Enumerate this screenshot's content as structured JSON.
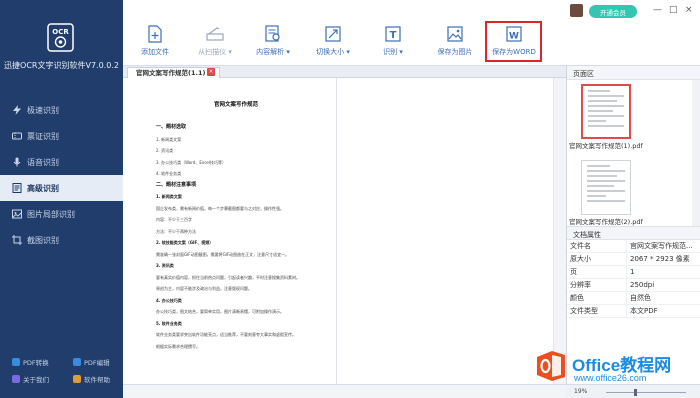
{
  "app": {
    "title": "迅捷OCR文字识别软件V7.0.0.2",
    "logo_text": "OCR"
  },
  "sidebar": {
    "items": [
      {
        "label": "极速识别",
        "icon": "lightning-icon"
      },
      {
        "label": "票证识别",
        "icon": "ticket-icon"
      },
      {
        "label": "语音识别",
        "icon": "microphone-icon"
      },
      {
        "label": "高级识别",
        "icon": "page-icon",
        "active": true
      },
      {
        "label": "图片局部识别",
        "icon": "crop-icon"
      },
      {
        "label": "截图识别",
        "icon": "screenshot-icon"
      }
    ],
    "bottom_links": [
      {
        "label": "PDF转换",
        "color": "#3a8be0"
      },
      {
        "label": "PDF编辑",
        "color": "#3a8be0"
      },
      {
        "label": "关于我们",
        "color": "#7a6be0"
      },
      {
        "label": "软件帮助",
        "color": "#e09a3a"
      }
    ]
  },
  "header": {
    "vip_label": "开通会员",
    "window_controls": [
      "—",
      "□",
      "×"
    ]
  },
  "toolbar": {
    "tools": [
      {
        "label": "添加文件",
        "icon": "add-file-icon"
      },
      {
        "label": "从扫描仪 ▾",
        "icon": "scanner-icon"
      },
      {
        "label": "内容解析 ▾",
        "icon": "parse-icon"
      },
      {
        "label": "切换大小 ▾",
        "icon": "resize-icon"
      },
      {
        "label": "识别 ▾",
        "icon": "recognize-icon"
      },
      {
        "label": "保存为图片",
        "icon": "save-image-icon"
      },
      {
        "label": "保存为WORD",
        "icon": "save-word-icon"
      }
    ]
  },
  "document": {
    "tab_label": "官网文案写作规范(1.1)",
    "title": "官网文案写作规范",
    "lines": [
      {
        "t": "一、题材选取",
        "cls": "h"
      },
      {
        "t": "1. 新闻类文案",
        "cls": ""
      },
      {
        "t": "2. 资讯类",
        "cls": ""
      },
      {
        "t": "3. 办公技巧类（Word、Excel技巧等）",
        "cls": ""
      },
      {
        "t": "4. 软件业务类",
        "cls": ""
      },
      {
        "t": "二、题材注意事项",
        "cls": "h"
      },
      {
        "t": "1. 新闻类文案",
        "cls": "sub"
      },
      {
        "t": "国企发布类，需有新闻价值，每一个步骤截图都要与之对应，操作性强。",
        "cls": ""
      },
      {
        "t": "内容：不少于三百字",
        "cls": ""
      },
      {
        "t": "方法：不少于两种方法",
        "cls": ""
      },
      {
        "t": "2. 软技能类文案（GIF、视频）",
        "cls": "sub"
      },
      {
        "t": "需准确一张封面GIF动图截图，需要将GIF动图放在正文，注意尺寸适宜一。",
        "cls": ""
      },
      {
        "t": "3. 资讯类",
        "cls": "sub"
      },
      {
        "t": "要有真实价值内容，抓住当前热点问题，引起读者兴趣，平时注意搜集资料素材。",
        "cls": ""
      },
      {
        "t": "原创为主，内容不能涉及政治与利益，注意版权问题。",
        "cls": ""
      },
      {
        "t": "4. 办公技巧类",
        "cls": "sub"
      },
      {
        "t": "办公技巧类，图文结合，要简单实用，图片清晰易懂，可附加操作演示。",
        "cls": ""
      },
      {
        "t": "5. 软件业务类",
        "cls": "sub"
      },
      {
        "t": "软件业务类要求突出软件功能亮点，适当推荐，不要刻意夸大事实和虚假宣传。",
        "cls": ""
      },
      {
        "t": "根据实际需求合理撰写。",
        "cls": ""
      }
    ]
  },
  "page_panel": {
    "title": "页面区",
    "thumbs": [
      {
        "label": "官网文案写作规范(1).pdf",
        "selected": true
      },
      {
        "label": "官网文案写作规范(2).pdf",
        "selected": false
      }
    ]
  },
  "properties": {
    "title": "文档属性",
    "rows": [
      {
        "k": "文件名",
        "v": "官网文案写作规范..."
      },
      {
        "k": "原大小",
        "v": "2067 * 2923 像素"
      },
      {
        "k": "页",
        "v": "1"
      },
      {
        "k": "分辨率",
        "v": "250dpi"
      },
      {
        "k": "颜色",
        "v": "自然色"
      },
      {
        "k": "文件类型",
        "v": "本文PDF"
      }
    ]
  },
  "statusbar": {
    "zoom": "19%"
  },
  "watermark": {
    "line1": "Office教程网",
    "line2": "www.office26.com"
  }
}
